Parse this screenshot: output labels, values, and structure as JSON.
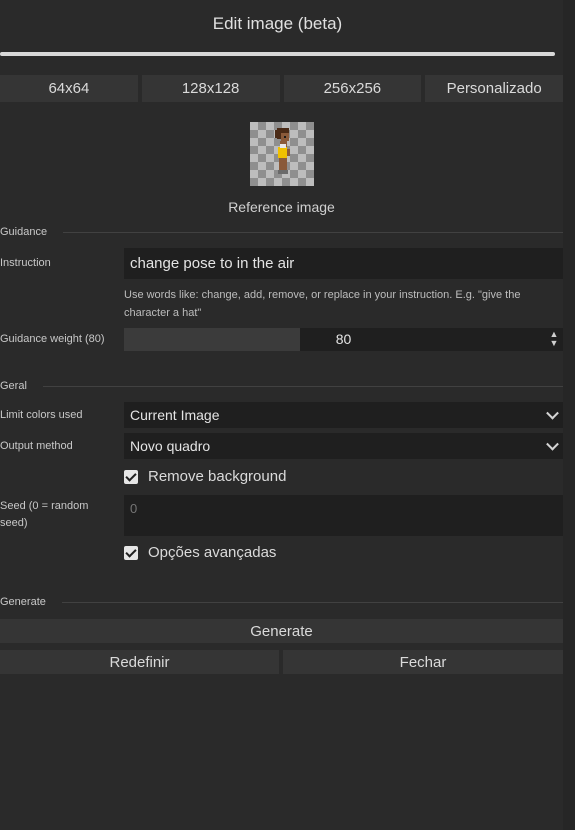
{
  "dialog": {
    "title": "Edit image (beta)"
  },
  "sizes": [
    "64x64",
    "128x128",
    "256x256",
    "Personalizado"
  ],
  "reference": {
    "caption": "Reference image"
  },
  "guidance": {
    "section_label": "Guidance",
    "instruction_label": "Instruction",
    "instruction_value": "change pose to in the air",
    "hint": "Use words like: change, add, remove, or replace in your instruction. E.g. \"give the character a hat\"",
    "weight_label": "Guidance weight (80)",
    "weight_value": "80",
    "weight_fraction": 0.4
  },
  "general": {
    "section_label": "Geral",
    "limit_colors_label": "Limit colors used",
    "limit_colors_value": "Current Image",
    "output_method_label": "Output method",
    "output_method_value": "Novo quadro",
    "remove_bg_label": "Remove background",
    "remove_bg_checked": true,
    "seed_label": "Seed (0 = random seed)",
    "seed_placeholder": "0",
    "advanced_label": "Opções avançadas",
    "advanced_checked": true
  },
  "generate": {
    "section_label": "Generate",
    "generate_label": "Generate",
    "reset_label": "Redefinir",
    "close_label": "Fechar"
  }
}
